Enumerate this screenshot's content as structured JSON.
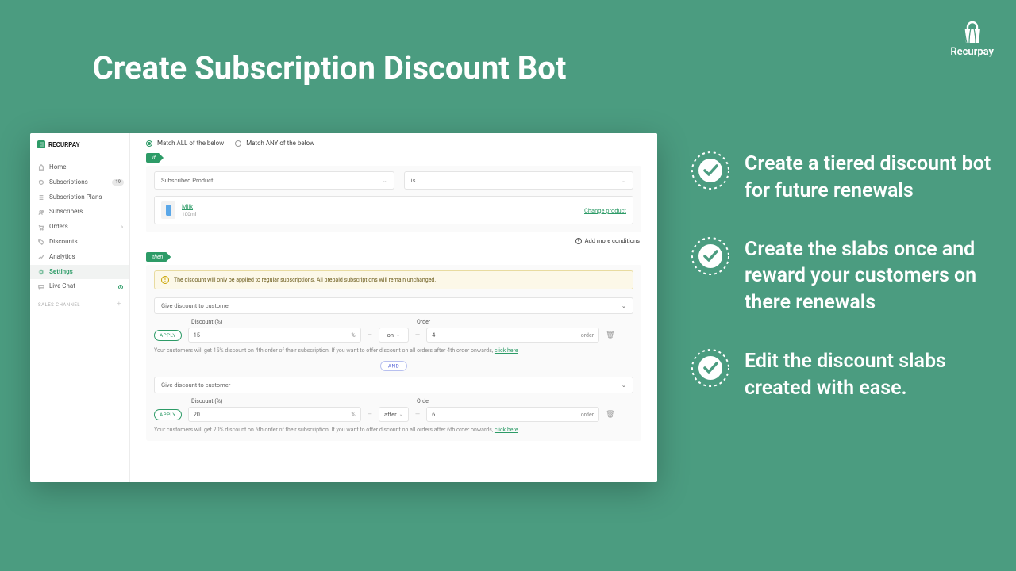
{
  "hero_title": "Create Subscription Discount Bot",
  "brand_name": "Recurpay",
  "benefits": [
    "Create a tiered discount bot for future renewals",
    "Create the slabs once and reward your customers on there renewals",
    "Edit the discount slabs created with ease."
  ],
  "sidebar": {
    "title": "RECURPAY",
    "items": [
      {
        "label": "Home"
      },
      {
        "label": "Subscriptions",
        "badge": "19"
      },
      {
        "label": "Subscription Plans"
      },
      {
        "label": "Subscribers"
      },
      {
        "label": "Orders",
        "chevron": true
      },
      {
        "label": "Discounts"
      },
      {
        "label": "Analytics"
      },
      {
        "label": "Settings",
        "active": true
      },
      {
        "label": "Live Chat",
        "dot": true
      }
    ],
    "section_label": "SALES CHANNEL"
  },
  "rule": {
    "match_all_label": "Match ALL of the below",
    "match_any_label": "Match ANY of the below",
    "match_mode": "all",
    "if_label": "if",
    "then_label": "then",
    "condition": {
      "field": "Subscribed Product",
      "operator": "is",
      "product_name": "Milk",
      "product_sub": "100ml",
      "change_label": "Change product"
    },
    "add_more_label": "Add more conditions",
    "info_banner": "The discount will only be applied to regular subscriptions. All prepaid subscriptions will remain unchanged.",
    "action_label": "Give discount to customer",
    "discount_header": "Discount (%)",
    "order_header": "Order",
    "percent_unit": "%",
    "order_unit": "order",
    "apply_label": "APPLY",
    "and_label": "AND",
    "click_here": "click here",
    "slabs": [
      {
        "discount": "15",
        "timing": "on",
        "order_n": "4",
        "hint_prefix": "Your customers will get 15% discount on 4th order of their subscription. If you want to offer discount on all orders after 4th order onwards, "
      },
      {
        "discount": "20",
        "timing": "after",
        "order_n": "6",
        "hint_prefix": "Your customers will get 20% discount on 6th order of their subscription. If you want to offer discount on all orders after 6th order onwards, "
      }
    ]
  }
}
